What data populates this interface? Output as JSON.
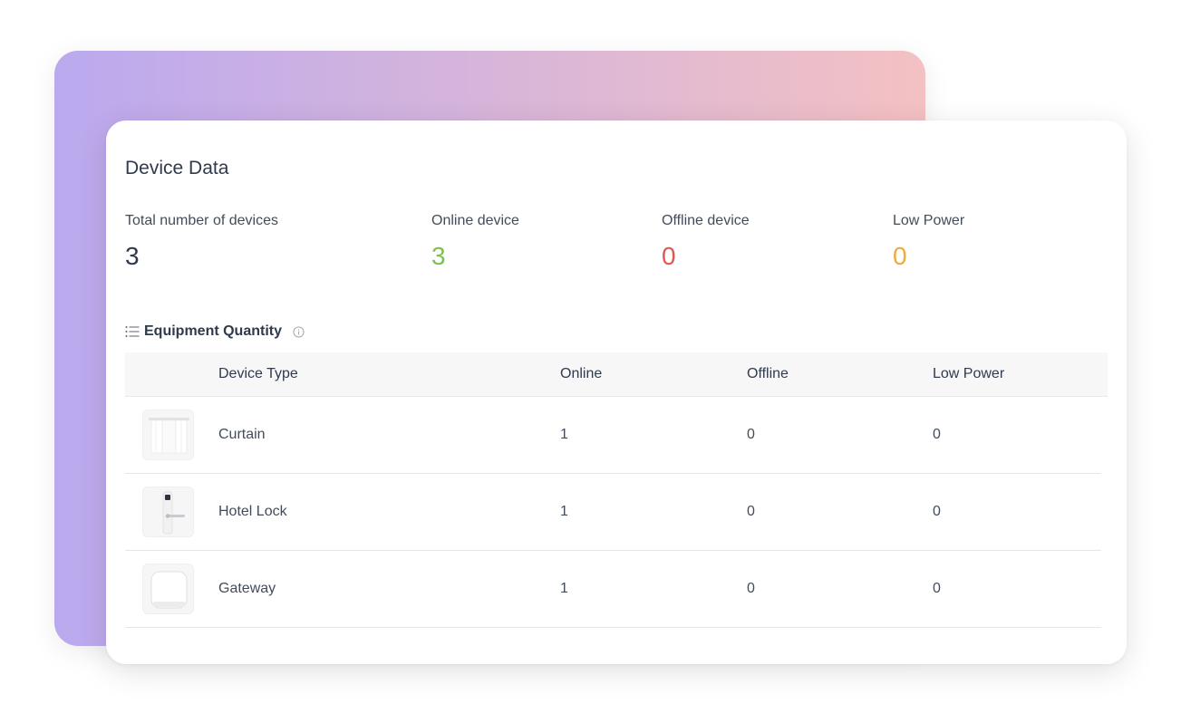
{
  "card": {
    "title": "Device Data"
  },
  "stats": [
    {
      "label": "Total number of devices",
      "value": "3",
      "color": "#2f3a4d"
    },
    {
      "label": "Online device",
      "value": "3",
      "color": "#7cc24a"
    },
    {
      "label": "Offline device",
      "value": "0",
      "color": "#e0574f"
    },
    {
      "label": "Low Power",
      "value": "0",
      "color": "#efab3d"
    }
  ],
  "section": {
    "title": "Equipment Quantity",
    "icon": "list-icon",
    "info_icon": "info-icon"
  },
  "table": {
    "headers": {
      "device_type": "Device Type",
      "online": "Online",
      "offline": "Offline",
      "low_power": "Low Power"
    },
    "rows": [
      {
        "device_type": "Curtain",
        "online": "1",
        "offline": "0",
        "low_power": "0",
        "thumbnail": "curtain-thumbnail"
      },
      {
        "device_type": "Hotel Lock",
        "online": "1",
        "offline": "0",
        "low_power": "0",
        "thumbnail": "hotel-lock-thumbnail"
      },
      {
        "device_type": "Gateway",
        "online": "1",
        "offline": "0",
        "low_power": "0",
        "thumbnail": "gateway-thumbnail"
      }
    ]
  },
  "colors": {
    "gradient_start": "#bba9ef",
    "gradient_end": "#f4c1c3",
    "text": "#2f3a4d"
  }
}
